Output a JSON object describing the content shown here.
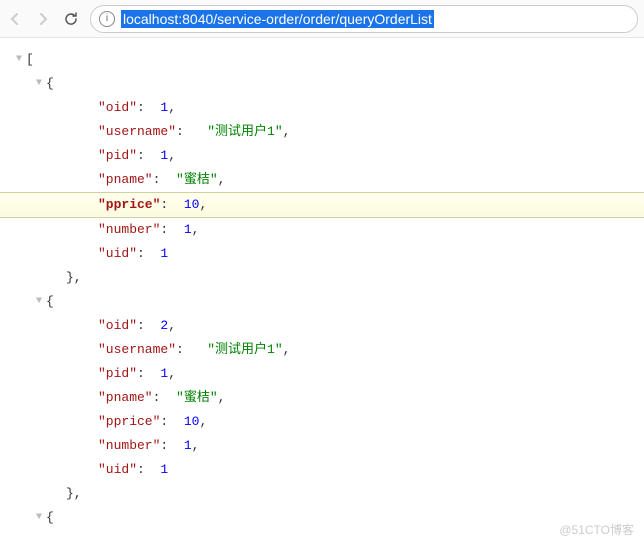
{
  "toolbar": {
    "url": "localhost:8040/service-order/order/queryOrderList"
  },
  "json": {
    "open_bracket": "[",
    "open_brace": "{",
    "close_brace": "}",
    "close_brace_comma": "},",
    "colon_sp": ":  ",
    "colon_lg": ":   ",
    "comma": ",",
    "obj1": {
      "oid_key": "\"oid\"",
      "oid_val": "1",
      "username_key": "\"username\"",
      "username_val": "\"测试用户1\"",
      "pid_key": "\"pid\"",
      "pid_val": "1",
      "pname_key": "\"pname\"",
      "pname_val": "\"蜜桔\"",
      "pprice_key": "\"pprice\"",
      "pprice_val": "10",
      "number_key": "\"number\"",
      "number_val": "1",
      "uid_key": "\"uid\"",
      "uid_val": "1"
    },
    "obj2": {
      "oid_key": "\"oid\"",
      "oid_val": "2",
      "username_key": "\"username\"",
      "username_val": "\"测试用户1\"",
      "pid_key": "\"pid\"",
      "pid_val": "1",
      "pname_key": "\"pname\"",
      "pname_val": "\"蜜桔\"",
      "pprice_key": "\"pprice\"",
      "pprice_val": "10",
      "number_key": "\"number\"",
      "number_val": "1",
      "uid_key": "\"uid\"",
      "uid_val": "1"
    }
  },
  "watermark": "@51CTO博客"
}
